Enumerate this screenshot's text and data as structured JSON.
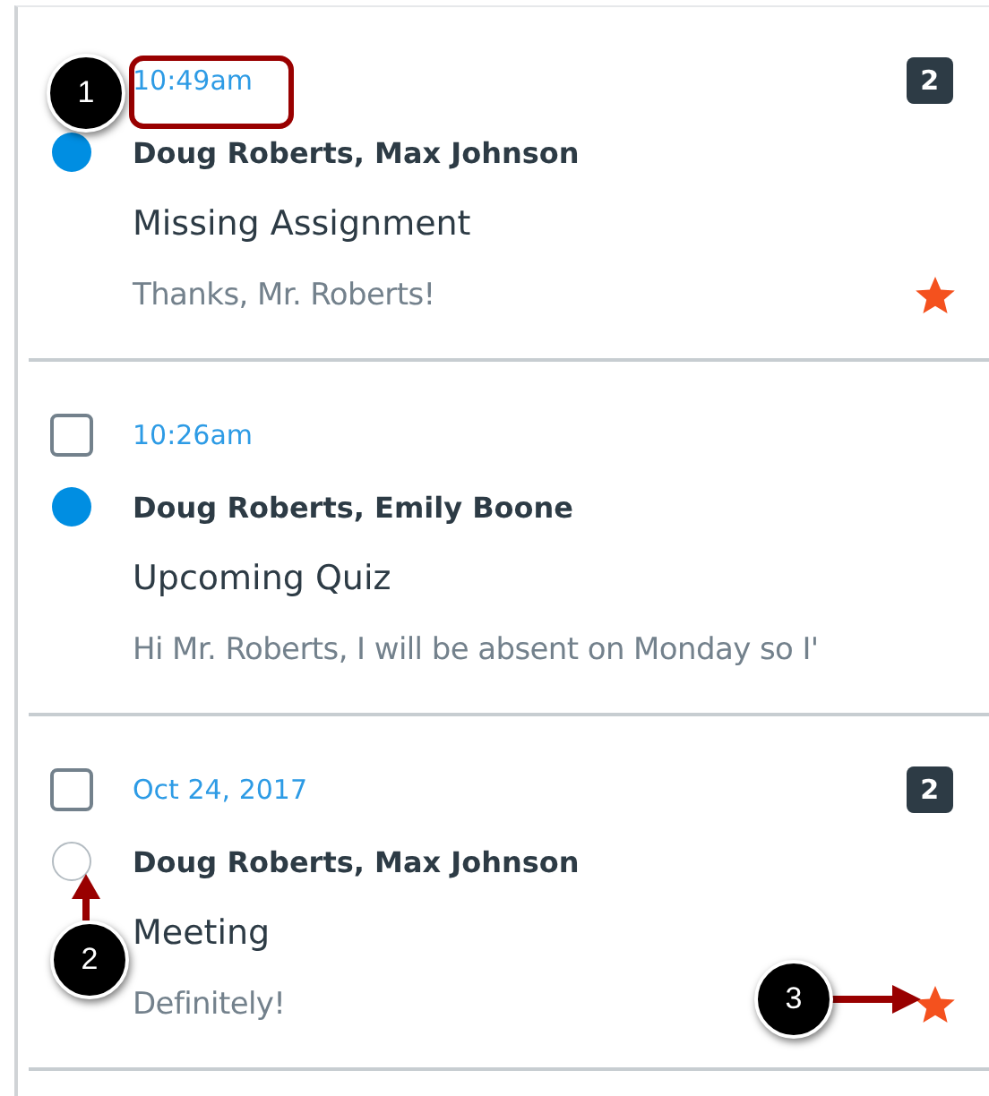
{
  "messages": [
    {
      "time": "10:49am",
      "count": "2",
      "unread": true,
      "participants": "Doug Roberts, Max Johnson",
      "subject": "Missing Assignment",
      "preview": "Thanks, Mr. Roberts!",
      "starred": true
    },
    {
      "time": "10:26am",
      "checked": false,
      "unread": true,
      "participants": "Doug Roberts, Emily Boone",
      "subject": "Upcoming Quiz",
      "preview": "Hi Mr. Roberts, I will be absent on Monday so I'",
      "starred": false
    },
    {
      "time": "Oct 24, 2017",
      "checked": false,
      "count": "2",
      "unread": false,
      "participants": "Doug Roberts, Max Johnson",
      "subject": "Meeting",
      "preview": "Definitely!",
      "starred": true
    }
  ],
  "callouts": [
    {
      "label": "1"
    },
    {
      "label": "2"
    },
    {
      "label": "3"
    }
  ]
}
